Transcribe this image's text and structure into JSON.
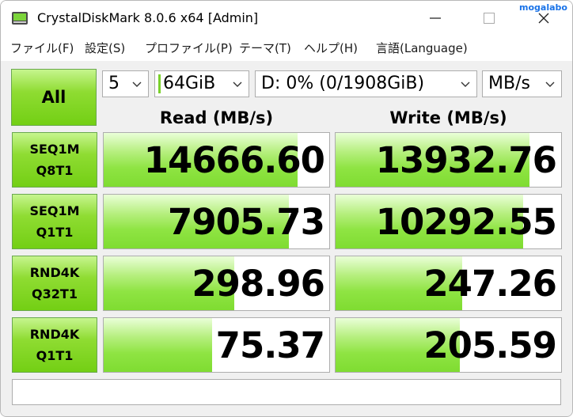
{
  "window": {
    "title": "CrystalDiskMark 8.0.6 x64 [Admin]",
    "watermark": "mogalabo"
  },
  "menu": [
    "ファイル(F)",
    "設定(S)",
    "プロファイル(P)",
    "テーマ(T)",
    "ヘルプ(H)",
    "言語(Language)"
  ],
  "controls": {
    "all_label": "All",
    "count": "5",
    "size": "64GiB",
    "drive": "D: 0% (0/1908GiB)",
    "unit": "MB/s"
  },
  "headers": {
    "read": "Read (MB/s)",
    "write": "Write (MB/s)"
  },
  "tests": [
    {
      "line1": "SEQ1M",
      "line2": "Q8T1",
      "read": "14666.60",
      "write": "13932.76",
      "read_fill": 0.86,
      "write_fill": 0.86
    },
    {
      "line1": "SEQ1M",
      "line2": "Q1T1",
      "read": "7905.73",
      "write": "10292.55",
      "read_fill": 0.82,
      "write_fill": 0.83
    },
    {
      "line1": "RND4K",
      "line2": "Q32T1",
      "read": "298.96",
      "write": "247.26",
      "read_fill": 0.58,
      "write_fill": 0.56
    },
    {
      "line1": "RND4K",
      "line2": "Q1T1",
      "read": "75.37",
      "write": "205.59",
      "read_fill": 0.48,
      "write_fill": 0.55
    }
  ],
  "comment": ""
}
